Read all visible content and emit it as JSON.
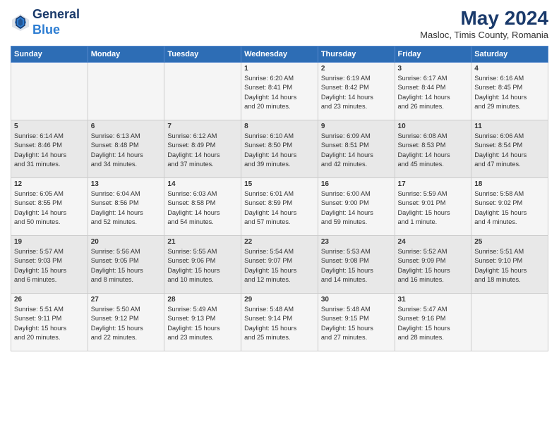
{
  "header": {
    "logo_line1": "General",
    "logo_line2": "Blue",
    "month_year": "May 2024",
    "location": "Masloc, Timis County, Romania"
  },
  "days_of_week": [
    "Sunday",
    "Monday",
    "Tuesday",
    "Wednesday",
    "Thursday",
    "Friday",
    "Saturday"
  ],
  "weeks": [
    [
      {
        "day": "",
        "info": ""
      },
      {
        "day": "",
        "info": ""
      },
      {
        "day": "",
        "info": ""
      },
      {
        "day": "1",
        "info": "Sunrise: 6:20 AM\nSunset: 8:41 PM\nDaylight: 14 hours\nand 20 minutes."
      },
      {
        "day": "2",
        "info": "Sunrise: 6:19 AM\nSunset: 8:42 PM\nDaylight: 14 hours\nand 23 minutes."
      },
      {
        "day": "3",
        "info": "Sunrise: 6:17 AM\nSunset: 8:44 PM\nDaylight: 14 hours\nand 26 minutes."
      },
      {
        "day": "4",
        "info": "Sunrise: 6:16 AM\nSunset: 8:45 PM\nDaylight: 14 hours\nand 29 minutes."
      }
    ],
    [
      {
        "day": "5",
        "info": "Sunrise: 6:14 AM\nSunset: 8:46 PM\nDaylight: 14 hours\nand 31 minutes."
      },
      {
        "day": "6",
        "info": "Sunrise: 6:13 AM\nSunset: 8:48 PM\nDaylight: 14 hours\nand 34 minutes."
      },
      {
        "day": "7",
        "info": "Sunrise: 6:12 AM\nSunset: 8:49 PM\nDaylight: 14 hours\nand 37 minutes."
      },
      {
        "day": "8",
        "info": "Sunrise: 6:10 AM\nSunset: 8:50 PM\nDaylight: 14 hours\nand 39 minutes."
      },
      {
        "day": "9",
        "info": "Sunrise: 6:09 AM\nSunset: 8:51 PM\nDaylight: 14 hours\nand 42 minutes."
      },
      {
        "day": "10",
        "info": "Sunrise: 6:08 AM\nSunset: 8:53 PM\nDaylight: 14 hours\nand 45 minutes."
      },
      {
        "day": "11",
        "info": "Sunrise: 6:06 AM\nSunset: 8:54 PM\nDaylight: 14 hours\nand 47 minutes."
      }
    ],
    [
      {
        "day": "12",
        "info": "Sunrise: 6:05 AM\nSunset: 8:55 PM\nDaylight: 14 hours\nand 50 minutes."
      },
      {
        "day": "13",
        "info": "Sunrise: 6:04 AM\nSunset: 8:56 PM\nDaylight: 14 hours\nand 52 minutes."
      },
      {
        "day": "14",
        "info": "Sunrise: 6:03 AM\nSunset: 8:58 PM\nDaylight: 14 hours\nand 54 minutes."
      },
      {
        "day": "15",
        "info": "Sunrise: 6:01 AM\nSunset: 8:59 PM\nDaylight: 14 hours\nand 57 minutes."
      },
      {
        "day": "16",
        "info": "Sunrise: 6:00 AM\nSunset: 9:00 PM\nDaylight: 14 hours\nand 59 minutes."
      },
      {
        "day": "17",
        "info": "Sunrise: 5:59 AM\nSunset: 9:01 PM\nDaylight: 15 hours\nand 1 minute."
      },
      {
        "day": "18",
        "info": "Sunrise: 5:58 AM\nSunset: 9:02 PM\nDaylight: 15 hours\nand 4 minutes."
      }
    ],
    [
      {
        "day": "19",
        "info": "Sunrise: 5:57 AM\nSunset: 9:03 PM\nDaylight: 15 hours\nand 6 minutes."
      },
      {
        "day": "20",
        "info": "Sunrise: 5:56 AM\nSunset: 9:05 PM\nDaylight: 15 hours\nand 8 minutes."
      },
      {
        "day": "21",
        "info": "Sunrise: 5:55 AM\nSunset: 9:06 PM\nDaylight: 15 hours\nand 10 minutes."
      },
      {
        "day": "22",
        "info": "Sunrise: 5:54 AM\nSunset: 9:07 PM\nDaylight: 15 hours\nand 12 minutes."
      },
      {
        "day": "23",
        "info": "Sunrise: 5:53 AM\nSunset: 9:08 PM\nDaylight: 15 hours\nand 14 minutes."
      },
      {
        "day": "24",
        "info": "Sunrise: 5:52 AM\nSunset: 9:09 PM\nDaylight: 15 hours\nand 16 minutes."
      },
      {
        "day": "25",
        "info": "Sunrise: 5:51 AM\nSunset: 9:10 PM\nDaylight: 15 hours\nand 18 minutes."
      }
    ],
    [
      {
        "day": "26",
        "info": "Sunrise: 5:51 AM\nSunset: 9:11 PM\nDaylight: 15 hours\nand 20 minutes."
      },
      {
        "day": "27",
        "info": "Sunrise: 5:50 AM\nSunset: 9:12 PM\nDaylight: 15 hours\nand 22 minutes."
      },
      {
        "day": "28",
        "info": "Sunrise: 5:49 AM\nSunset: 9:13 PM\nDaylight: 15 hours\nand 23 minutes."
      },
      {
        "day": "29",
        "info": "Sunrise: 5:48 AM\nSunset: 9:14 PM\nDaylight: 15 hours\nand 25 minutes."
      },
      {
        "day": "30",
        "info": "Sunrise: 5:48 AM\nSunset: 9:15 PM\nDaylight: 15 hours\nand 27 minutes."
      },
      {
        "day": "31",
        "info": "Sunrise: 5:47 AM\nSunset: 9:16 PM\nDaylight: 15 hours\nand 28 minutes."
      },
      {
        "day": "",
        "info": ""
      }
    ]
  ]
}
